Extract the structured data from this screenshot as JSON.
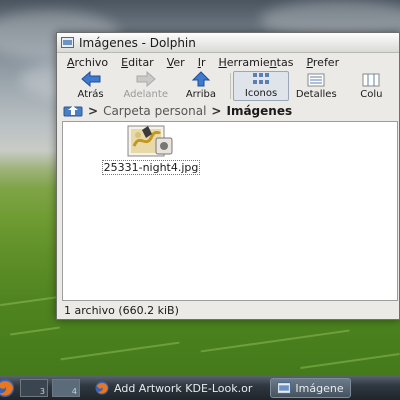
{
  "window": {
    "title": "Imágenes - Dolphin"
  },
  "menubar": {
    "items": [
      {
        "accel": "A",
        "rest": "rchivo"
      },
      {
        "accel": "E",
        "rest": "ditar"
      },
      {
        "accel": "V",
        "rest": "er"
      },
      {
        "accel": "I",
        "rest": "r"
      },
      {
        "accel": "H",
        "rest": "erramie",
        "accel2": "n",
        "rest2": "tas"
      },
      {
        "accel": "P",
        "rest": "refer"
      }
    ]
  },
  "toolbar": {
    "back_label": "Atrás",
    "forward_label": "Adelante",
    "up_label": "Arriba",
    "icons_label": "Iconos",
    "details_label": "Detalles",
    "columns_label": "Colu"
  },
  "breadcrumb": {
    "home_label": "Carpeta personal",
    "current_label": "Imágenes"
  },
  "files": [
    {
      "name": "25331-night4.jpg",
      "icon": "image-file-icon"
    }
  ],
  "status": {
    "text": "1 archivo (660.2 kiB)"
  },
  "taskbar": {
    "pager_numbers": [
      "3",
      "4"
    ],
    "tasks": [
      {
        "label": "Add Artwork KDE-Look.or",
        "icon": "firefox-icon"
      },
      {
        "label": "Imágene",
        "icon": "dolphin-icon"
      }
    ]
  },
  "colors": {
    "accent": "#4a7fc1",
    "window_bg": "#eceae6",
    "taskbar_bg": "#2f3740"
  }
}
